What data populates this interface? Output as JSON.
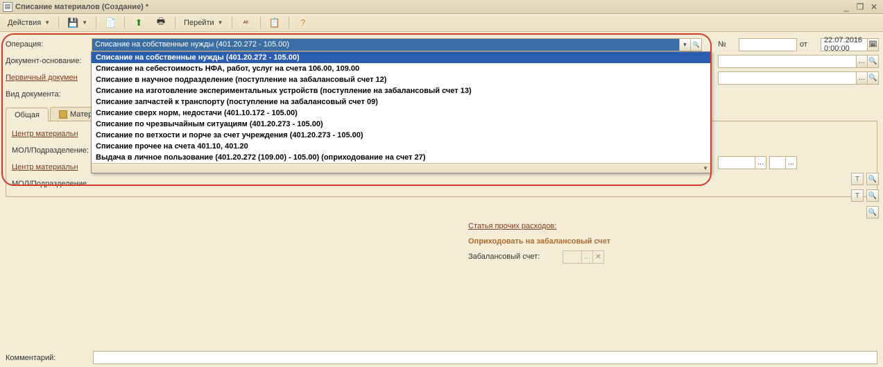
{
  "window": {
    "title": "Списание материалов (Создание) *"
  },
  "toolbar": {
    "actions_label": "Действия",
    "goto_label": "Перейти"
  },
  "labels": {
    "operation": "Операция:",
    "basis_doc": "Документ-основание:",
    "primary_doc": "Первичный докумен",
    "doc_type": "Вид документа:",
    "number": "№",
    "from": "от",
    "center1": "Центр материальн",
    "mol1": "МОЛ/Подразделение:",
    "center2": "Центр материальн",
    "mol2": "МОЛ/Подразделение",
    "expense_article": "Статья прочих расходов:",
    "booking_group": "Оприходовать на забалансовый счет",
    "offbalance_account": "Забалансовый счет:",
    "comment": "Комментарий:"
  },
  "fields": {
    "operation_value": "Списание на собственные нужды (401.20.272 - 105.00)",
    "date_value": "22.07.2016 0:00:00"
  },
  "tabs": [
    {
      "label": "Общая"
    },
    {
      "label": "Матер"
    }
  ],
  "dropdown": {
    "items": [
      "Списание на собственные нужды (401.20.272 - 105.00)",
      "Списание на себестоимость НФА, работ, услуг на счета 106.00, 109.00",
      "Списание в научное подразделение (поступление на забалансовый счет 12)",
      "Списание на изготовление экспериментальных устройств (поступление на забалансовый счет 13)",
      "Списание запчастей к транспорту (поступление на забалансовый счет 09)",
      "Списание сверх норм, недостачи (401.10.172 - 105.00)",
      "Списание по чрезвычайным ситуациям (401.20.273 - 105.00)",
      "Списание по ветхости и порче за счет учреждения (401.20.273 - 105.00)",
      "Списание прочее на счета 401.10, 401.20",
      "Выдача в личное пользование (401.20.272 (109.00) - 105.00) (оприходование на счет 27)"
    ],
    "selected_index": 0
  }
}
